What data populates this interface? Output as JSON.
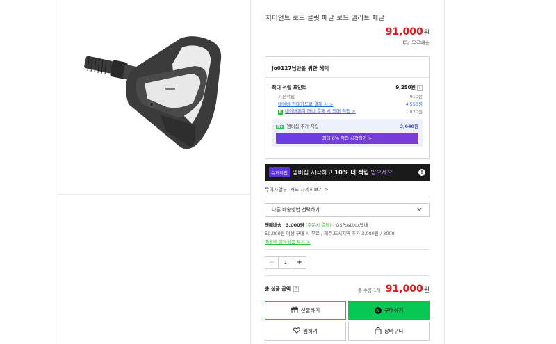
{
  "product": {
    "title": "지이언트 로드 클릿 페달 로드 엘리트 페달",
    "price": "91,000",
    "currency_unit": "원",
    "shipping_label": "무료배송"
  },
  "benefit": {
    "header": "jo0127님만을 위한 혜택",
    "max_points_label": "최대 적립 포인트",
    "max_points_value": "9,250원",
    "basic_label": "기본적립",
    "basic_value": "910원",
    "card_label": "네이버 현대카드로 결제 시 >",
    "card_value": "4,550원",
    "money_label": "네이버페이 머니 결제 시 최대 적립 >",
    "money_value": "1,820원",
    "membership_tag": "N+",
    "membership_label": "멤버십 추가 적립",
    "membership_value": "3,640원",
    "membership_button": "최대 6% 적립 시작하기 >"
  },
  "promo": {
    "tag": "슈퍼적립",
    "text_before": "멤버십 시작하고 ",
    "highlight": "10% 더 적립",
    "text_after": " 받으세요",
    "info": "!"
  },
  "card_info": {
    "label": "무이자할부",
    "link": "카드 자세히보기 >"
  },
  "shipping": {
    "select_placeholder": "다른 배송방법 선택하기",
    "method": "택배배송",
    "fee": "3,000원",
    "fee_note": "(주문시 결제)",
    "carrier": "- GSPostbox택배",
    "free_condition": "50,000원 이상 구매 시 무료 / 제주,도서지역 추가 3,000원 / 3000",
    "policy_link": "배송비 절약상품 보기 >"
  },
  "quantity": {
    "minus": "−",
    "value": "1",
    "plus": "+"
  },
  "total": {
    "label": "총 상품 금액",
    "count": "총 수량 1개",
    "price": "91,000",
    "unit": "원"
  },
  "buttons": {
    "gift": "선물하기",
    "buy": "구매하기",
    "wish": "찜하기",
    "cart": "장바구니"
  },
  "colors": {
    "price": "#d81820",
    "naver_green": "#07c755",
    "membership_purple": "#6a3de8"
  },
  "icons": [
    "pedal-product-image",
    "truck-icon",
    "question-icon",
    "chevron-down-icon",
    "gift-icon",
    "naver-n-icon",
    "heart-icon",
    "cart-icon",
    "info-icon"
  ]
}
